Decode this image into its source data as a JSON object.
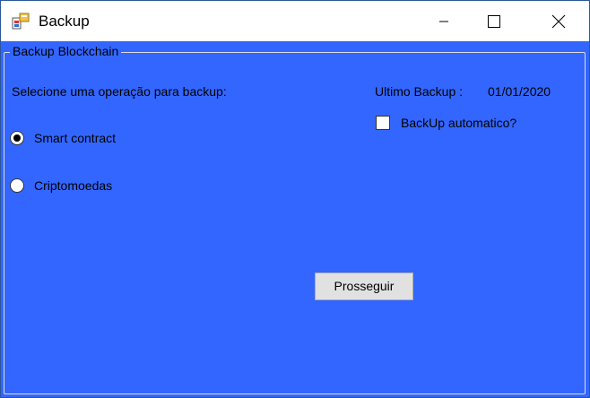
{
  "window": {
    "title": "Backup",
    "icon": "backup-app-icon",
    "controls": [
      "minimize-icon",
      "maximize-icon",
      "close-icon"
    ]
  },
  "form": {
    "background_color": "#3366ff",
    "group_title": "Backup Blockchain",
    "operation_prompt": "Selecione uma operação para backup:",
    "options": [
      {
        "label": "Smart contract",
        "selected": true
      },
      {
        "label": "Criptomoedas",
        "selected": false
      }
    ],
    "last_backup_label": "Ultimo Backup :",
    "last_backup_date": "01/01/2020",
    "auto_backup_label": "BackUp automatico?",
    "auto_backup_checked": false,
    "proceed_button_label": "Prosseguir"
  }
}
